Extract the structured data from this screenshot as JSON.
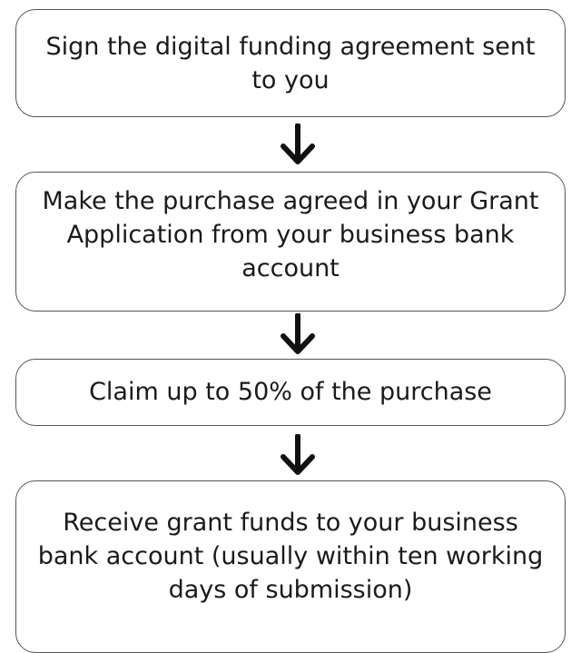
{
  "steps": [
    {
      "label": "Sign the digital funding agreement sent to you"
    },
    {
      "label": "Make the purchase agreed in your Grant Application from your business bank account"
    },
    {
      "label": "Claim up to 50% of the purchase"
    },
    {
      "label": "Receive grant funds to your business bank account (usually within ten working days of submission)"
    }
  ],
  "colors": {
    "border": "#555555",
    "arrow": "#111111",
    "text": "#1a1a1a",
    "background": "#ffffff"
  },
  "icons": {
    "connector": "arrow-down-icon"
  }
}
